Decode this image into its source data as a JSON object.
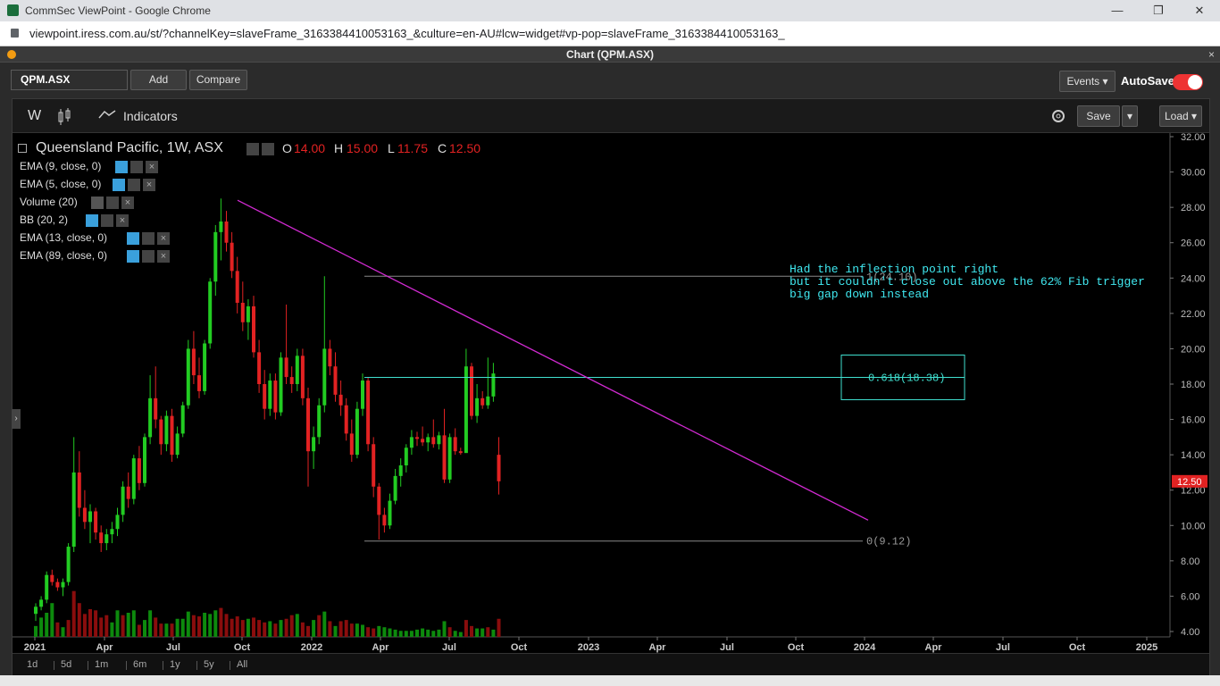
{
  "browser": {
    "window_title": "CommSec ViewPoint - Google Chrome",
    "url": "viewpoint.iress.com.au/st/?channelKey=slaveFrame_3163384410053163_&culture=en-AU#lcw=widget#vp-pop=slaveFrame_3163384410053163_",
    "minimize": "—",
    "restore": "❐",
    "close": "✕"
  },
  "panel": {
    "title": "Chart (QPM.ASX)",
    "close": "×"
  },
  "controls": {
    "symbol": "QPM.ASX",
    "add": "Add",
    "compare": "Compare",
    "events": "Events ▾",
    "autosave": "AutoSave",
    "autosave_on": true
  },
  "toolbar": {
    "interval": "W",
    "indicators": "Indicators",
    "save": "Save",
    "save_dropdown": "▾",
    "load": "Load ▾"
  },
  "legend": {
    "title": "Queensland Pacific, 1W, ASX",
    "o_label": "O",
    "o": "14.00",
    "h_label": "H",
    "h": "15.00",
    "l_label": "L",
    "l": "11.75",
    "c_label": "C",
    "c": "12.50",
    "indicators": [
      {
        "label": "EMA (9, close, 0)",
        "visible": true
      },
      {
        "label": "EMA (5, close, 0)",
        "visible": true
      },
      {
        "label": "Volume (20)",
        "visible": false
      },
      {
        "label": "BB (20, 2)",
        "visible": true
      },
      {
        "label": "EMA (13, close, 0)",
        "visible": true
      },
      {
        "label": "EMA (89, close, 0)",
        "visible": true
      }
    ]
  },
  "annotation": {
    "lines": [
      "Had the inflection point right",
      "but it couldn't close out above the 62% Fib trigger",
      "big gap down instead"
    ],
    "fib_top": "1(24.10)",
    "fib_mid": "0.618(18.38)",
    "fib_bottom": "0(9.12)"
  },
  "colors": {
    "up": "#22cc22",
    "down": "#e22222",
    "trendline": "#d22ad2",
    "fib_mid": "#40e0d0",
    "annotation": "#40e8f0",
    "last_price_bg": "#e22222"
  },
  "range_buttons": [
    "1d",
    "5d",
    "1m",
    "6m",
    "1y",
    "5y",
    "All"
  ],
  "chart_data": {
    "type": "candlestick",
    "title": "Queensland Pacific, 1W, ASX",
    "y_ticks": [
      "32.00",
      "30.00",
      "28.00",
      "26.00",
      "24.00",
      "22.00",
      "20.00",
      "18.00",
      "16.00",
      "14.00",
      "12.00",
      "10.00",
      "8.00",
      "6.00",
      "4.00"
    ],
    "ylim": [
      4,
      32
    ],
    "x_ticks": [
      "2021",
      "Apr",
      "Jul",
      "Oct",
      "2022",
      "Apr",
      "Jul",
      "Oct",
      "2023",
      "Apr",
      "Jul",
      "Oct",
      "2024",
      "Apr",
      "Jul",
      "Oct",
      "2025"
    ],
    "last_price": "12.50",
    "fib_levels": [
      {
        "ratio": 1,
        "value": 24.1
      },
      {
        "ratio": 0.618,
        "value": 18.38
      },
      {
        "ratio": 0,
        "value": 9.12
      }
    ],
    "trendline": {
      "from": {
        "date": "2021-09",
        "value": 28.4
      },
      "to": {
        "date": "2023-12",
        "value": 10.3
      }
    },
    "candles": [
      [
        5.0,
        5.6,
        4.6,
        5.4
      ],
      [
        5.4,
        6.0,
        5.2,
        5.8
      ],
      [
        5.8,
        7.4,
        5.6,
        7.2
      ],
      [
        7.2,
        7.5,
        6.6,
        6.8
      ],
      [
        6.8,
        7.0,
        6.3,
        6.5
      ],
      [
        6.5,
        7.0,
        6.0,
        6.8
      ],
      [
        6.8,
        9.0,
        6.6,
        8.8
      ],
      [
        8.8,
        15.0,
        8.5,
        13.0
      ],
      [
        13.0,
        14.2,
        10.5,
        11.0
      ],
      [
        11.0,
        12.0,
        9.8,
        10.2
      ],
      [
        10.2,
        11.2,
        9.0,
        10.8
      ],
      [
        10.8,
        11.0,
        9.2,
        9.6
      ],
      [
        9.6,
        10.0,
        8.5,
        9.0
      ],
      [
        9.0,
        9.8,
        8.6,
        9.5
      ],
      [
        9.5,
        10.2,
        9.0,
        9.8
      ],
      [
        9.8,
        11.0,
        9.4,
        10.6
      ],
      [
        10.6,
        12.5,
        10.2,
        12.2
      ],
      [
        12.2,
        13.0,
        11.0,
        11.5
      ],
      [
        11.5,
        14.0,
        11.2,
        13.8
      ],
      [
        13.8,
        14.5,
        12.0,
        12.4
      ],
      [
        12.4,
        15.2,
        12.2,
        15.0
      ],
      [
        15.0,
        18.5,
        14.6,
        17.2
      ],
      [
        17.2,
        19.0,
        15.5,
        16.0
      ],
      [
        16.0,
        16.2,
        14.0,
        14.6
      ],
      [
        14.6,
        16.5,
        14.2,
        16.2
      ],
      [
        16.2,
        16.6,
        13.6,
        14.0
      ],
      [
        14.0,
        15.6,
        13.8,
        15.2
      ],
      [
        15.2,
        17.0,
        15.0,
        16.8
      ],
      [
        16.8,
        20.5,
        16.6,
        20.0
      ],
      [
        20.0,
        21.0,
        18.0,
        18.5
      ],
      [
        18.5,
        19.5,
        17.2,
        17.6
      ],
      [
        17.6,
        20.5,
        17.4,
        20.3
      ],
      [
        20.3,
        24.0,
        20.0,
        23.8
      ],
      [
        23.8,
        27.0,
        23.0,
        26.6
      ],
      [
        26.6,
        28.5,
        25.0,
        27.2
      ],
      [
        27.2,
        27.8,
        25.5,
        26.0
      ],
      [
        26.0,
        26.6,
        24.0,
        24.4
      ],
      [
        24.4,
        25.2,
        22.0,
        22.6
      ],
      [
        22.6,
        23.8,
        21.0,
        21.5
      ],
      [
        21.5,
        22.8,
        20.5,
        22.4
      ],
      [
        22.4,
        23.0,
        19.5,
        19.8
      ],
      [
        19.8,
        20.5,
        17.5,
        18.0
      ],
      [
        18.0,
        18.8,
        16.0,
        16.6
      ],
      [
        16.6,
        18.6,
        16.2,
        18.2
      ],
      [
        18.2,
        18.6,
        16.0,
        16.4
      ],
      [
        16.4,
        19.8,
        16.2,
        19.5
      ],
      [
        19.5,
        22.5,
        18.0,
        18.4
      ],
      [
        18.4,
        19.0,
        17.5,
        18.0
      ],
      [
        18.0,
        20.0,
        17.6,
        19.6
      ],
      [
        19.6,
        20.0,
        16.8,
        17.2
      ],
      [
        17.2,
        17.8,
        12.2,
        14.2
      ],
      [
        14.2,
        15.6,
        13.2,
        15.0
      ],
      [
        15.0,
        17.2,
        14.6,
        16.8
      ],
      [
        16.8,
        24.1,
        16.4,
        20.0
      ],
      [
        20.0,
        20.5,
        18.5,
        19.0
      ],
      [
        19.0,
        19.8,
        17.0,
        17.4
      ],
      [
        17.4,
        18.2,
        16.2,
        16.8
      ],
      [
        16.8,
        17.2,
        14.8,
        15.2
      ],
      [
        15.2,
        16.0,
        13.6,
        14.0
      ],
      [
        14.0,
        17.0,
        13.8,
        16.6
      ],
      [
        16.6,
        18.6,
        16.2,
        18.2
      ],
      [
        18.2,
        18.4,
        14.2,
        14.6
      ],
      [
        14.6,
        15.0,
        11.6,
        12.2
      ],
      [
        12.2,
        12.4,
        9.2,
        10.6
      ],
      [
        10.6,
        11.0,
        9.6,
        10.0
      ],
      [
        10.0,
        11.8,
        9.8,
        11.4
      ],
      [
        11.4,
        13.2,
        11.2,
        12.8
      ],
      [
        12.8,
        13.8,
        12.2,
        13.4
      ],
      [
        13.4,
        14.6,
        13.0,
        14.4
      ],
      [
        14.4,
        15.4,
        14.0,
        15.0
      ],
      [
        15.0,
        15.3,
        14.5,
        14.9
      ],
      [
        14.9,
        15.6,
        14.5,
        14.7
      ],
      [
        14.7,
        15.2,
        14.2,
        15.0
      ],
      [
        15.0,
        16.0,
        14.4,
        14.6
      ],
      [
        14.6,
        15.3,
        14.3,
        15.1
      ],
      [
        15.1,
        16.6,
        12.4,
        12.6
      ],
      [
        12.6,
        15.2,
        12.4,
        15.0
      ],
      [
        15.0,
        15.5,
        14.0,
        14.2
      ],
      [
        14.2,
        14.4,
        14.0,
        14.1
      ],
      [
        14.1,
        20.0,
        16.0,
        19.0
      ],
      [
        19.0,
        19.2,
        16.0,
        16.2
      ],
      [
        16.2,
        18.0,
        15.8,
        17.2
      ],
      [
        17.2,
        17.6,
        16.6,
        16.8
      ],
      [
        16.8,
        19.5,
        16.6,
        17.3
      ],
      [
        17.3,
        19.2,
        17.0,
        18.6
      ],
      [
        14.0,
        15.0,
        11.75,
        12.5
      ]
    ],
    "volume": [
      [
        9,
        "up"
      ],
      [
        16,
        "up"
      ],
      [
        20,
        "up"
      ],
      [
        28,
        "up"
      ],
      [
        12,
        "down"
      ],
      [
        8,
        "up"
      ],
      [
        14,
        "down"
      ],
      [
        38,
        "down"
      ],
      [
        28,
        "down"
      ],
      [
        19,
        "down"
      ],
      [
        23,
        "down"
      ],
      [
        22,
        "down"
      ],
      [
        16,
        "down"
      ],
      [
        18,
        "down"
      ],
      [
        12,
        "up"
      ],
      [
        22,
        "up"
      ],
      [
        18,
        "down"
      ],
      [
        20,
        "up"
      ],
      [
        22,
        "up"
      ],
      [
        10,
        "down"
      ],
      [
        14,
        "up"
      ],
      [
        22,
        "up"
      ],
      [
        16,
        "down"
      ],
      [
        11,
        "down"
      ],
      [
        11,
        "up"
      ],
      [
        11,
        "down"
      ],
      [
        15,
        "up"
      ],
      [
        15,
        "up"
      ],
      [
        21,
        "up"
      ],
      [
        18,
        "down"
      ],
      [
        17,
        "down"
      ],
      [
        20,
        "up"
      ],
      [
        19,
        "up"
      ],
      [
        22,
        "up"
      ],
      [
        24,
        "down"
      ],
      [
        19,
        "down"
      ],
      [
        15,
        "down"
      ],
      [
        17,
        "down"
      ],
      [
        14,
        "down"
      ],
      [
        15,
        "up"
      ],
      [
        16,
        "down"
      ],
      [
        14,
        "down"
      ],
      [
        12,
        "down"
      ],
      [
        13,
        "up"
      ],
      [
        11,
        "down"
      ],
      [
        14,
        "up"
      ],
      [
        15,
        "down"
      ],
      [
        18,
        "down"
      ],
      [
        19,
        "up"
      ],
      [
        12,
        "down"
      ],
      [
        9,
        "down"
      ],
      [
        14,
        "up"
      ],
      [
        18,
        "down"
      ],
      [
        21,
        "up"
      ],
      [
        13,
        "down"
      ],
      [
        9,
        "up"
      ],
      [
        13,
        "down"
      ],
      [
        14,
        "down"
      ],
      [
        11,
        "down"
      ],
      [
        11,
        "up"
      ],
      [
        10,
        "up"
      ],
      [
        8,
        "down"
      ],
      [
        7,
        "down"
      ],
      [
        9,
        "up"
      ],
      [
        8,
        "up"
      ],
      [
        7,
        "up"
      ],
      [
        6,
        "up"
      ],
      [
        5,
        "up"
      ],
      [
        5,
        "up"
      ],
      [
        5,
        "up"
      ],
      [
        6,
        "up"
      ],
      [
        7,
        "up"
      ],
      [
        6,
        "up"
      ],
      [
        5,
        "up"
      ],
      [
        6,
        "up"
      ],
      [
        13,
        "up"
      ],
      [
        8,
        "down"
      ],
      [
        5,
        "up"
      ],
      [
        4,
        "up"
      ],
      [
        14,
        "down"
      ],
      [
        9,
        "down"
      ],
      [
        7,
        "up"
      ],
      [
        7,
        "up"
      ],
      [
        8,
        "down"
      ],
      [
        6,
        "up"
      ],
      [
        15,
        "down"
      ]
    ]
  }
}
